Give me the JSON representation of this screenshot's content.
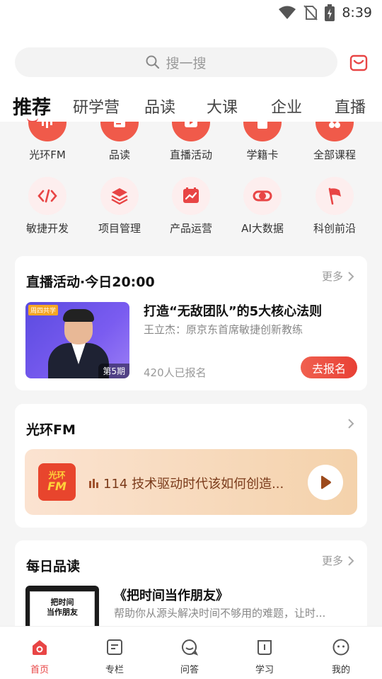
{
  "status_bar": {
    "time": "8:39"
  },
  "search": {
    "placeholder": "搜一搜"
  },
  "tabs": [
    {
      "label": "推荐",
      "active": true
    },
    {
      "label": "研学营"
    },
    {
      "label": "品读"
    },
    {
      "label": "大课"
    },
    {
      "label": "企业"
    },
    {
      "label": "直播"
    }
  ],
  "quick_icons": [
    {
      "label": "光环FM",
      "icon": "fm-icon"
    },
    {
      "label": "品读",
      "icon": "reading-icon"
    },
    {
      "label": "直播活动",
      "icon": "live-icon"
    },
    {
      "label": "学籍卡",
      "icon": "card-icon"
    },
    {
      "label": "全部课程",
      "icon": "courses-icon"
    },
    {
      "label": "敏捷开发",
      "icon": "code-icon"
    },
    {
      "label": "项目管理",
      "icon": "layers-icon"
    },
    {
      "label": "产品运营",
      "icon": "chart-icon"
    },
    {
      "label": "AI大数据",
      "icon": "ai-icon"
    },
    {
      "label": "科创前沿",
      "icon": "flag-icon"
    }
  ],
  "live_card": {
    "title": "直播活动·今日20:00",
    "more": "更多",
    "thumb_tag": "周四共学",
    "thumb_issue": "第5期",
    "event_title": "打造“无敌团队”的5大核心法则",
    "speaker": "王立杰：原京东首席敏捷创新教练",
    "signups": "420人已报名",
    "signup_button": "去报名"
  },
  "fm_card": {
    "title": "光环FM",
    "logo_top": "光环",
    "logo_bottom": "FM",
    "track": "114 技术驱动时代该如何创造..."
  },
  "reading_card": {
    "title": "每日品读",
    "more": "更多",
    "cover_text_1": "把时间",
    "cover_text_2": "当作朋友",
    "book_title": "《把时间当作朋友》",
    "book_desc": "帮助你从源头解决时间不够用的难题，让时..."
  },
  "bottom_nav": [
    {
      "label": "首页",
      "icon": "home-icon",
      "active": true
    },
    {
      "label": "专栏",
      "icon": "column-icon"
    },
    {
      "label": "问答",
      "icon": "qa-icon"
    },
    {
      "label": "学习",
      "icon": "study-icon"
    },
    {
      "label": "我的",
      "icon": "profile-icon"
    }
  ],
  "colors": {
    "accent": "#e84545",
    "fm_bg": "#f4d2ab"
  }
}
